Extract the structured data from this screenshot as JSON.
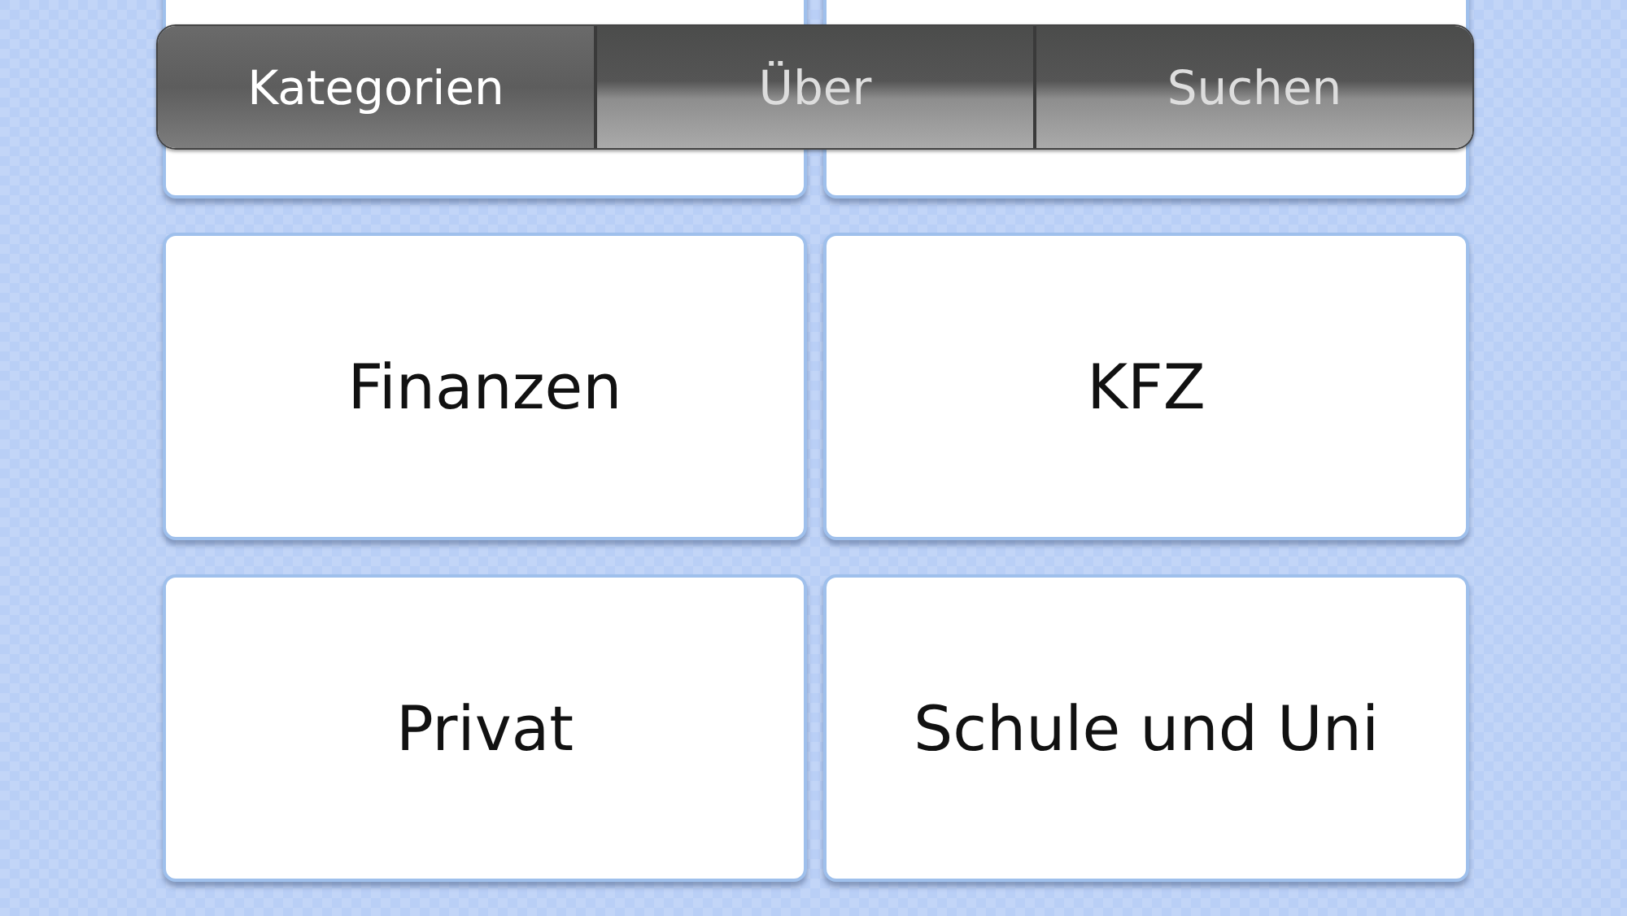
{
  "tabs": [
    {
      "label": "Kategorien",
      "selected": true
    },
    {
      "label": "Über",
      "selected": false
    },
    {
      "label": "Suchen",
      "selected": false
    }
  ],
  "cards": [
    {
      "label": "Finanzen"
    },
    {
      "label": "KFZ"
    },
    {
      "label": "Privat"
    },
    {
      "label": "Schule und Uni"
    }
  ]
}
